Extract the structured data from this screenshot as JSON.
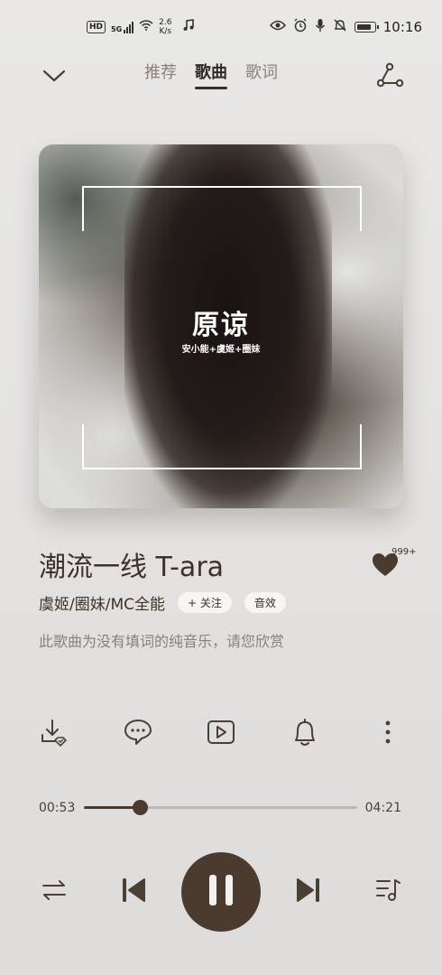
{
  "status_bar": {
    "hd": "HD",
    "signal": "5G",
    "net_speed_value": "2.6",
    "net_speed_unit": "K/s",
    "time": "10:16"
  },
  "nav": {
    "tabs": [
      {
        "label": "推荐",
        "active": false
      },
      {
        "label": "歌曲",
        "active": true
      },
      {
        "label": "歌词",
        "active": false
      }
    ]
  },
  "cover": {
    "title": "原谅",
    "subtitle": "安小能+虞姬+圈妹"
  },
  "song": {
    "title": "潮流一线 T-ara",
    "artist": "虞姬/圈妹/MC全能",
    "follow_label": "+ 关注",
    "effect_label": "音效",
    "notice": "此歌曲为没有填词的纯音乐，请您欣赏",
    "like_count": "999+"
  },
  "actions": [
    {
      "name": "download-icon"
    },
    {
      "name": "comment-icon"
    },
    {
      "name": "video-icon"
    },
    {
      "name": "bell-icon"
    },
    {
      "name": "more-icon"
    }
  ],
  "progress": {
    "current": "00:53",
    "total": "04:21",
    "fraction": 0.203
  },
  "controls": {
    "mode_icon": "repeat-list-icon",
    "prev_icon": "previous-icon",
    "play_icon": "pause-icon",
    "next_icon": "next-icon",
    "playlist_icon": "playlist-icon"
  },
  "colors": {
    "accent": "#4a3b2e",
    "background": "#e6e5e3",
    "text_primary": "#3d3128",
    "text_secondary": "#8a8079"
  }
}
